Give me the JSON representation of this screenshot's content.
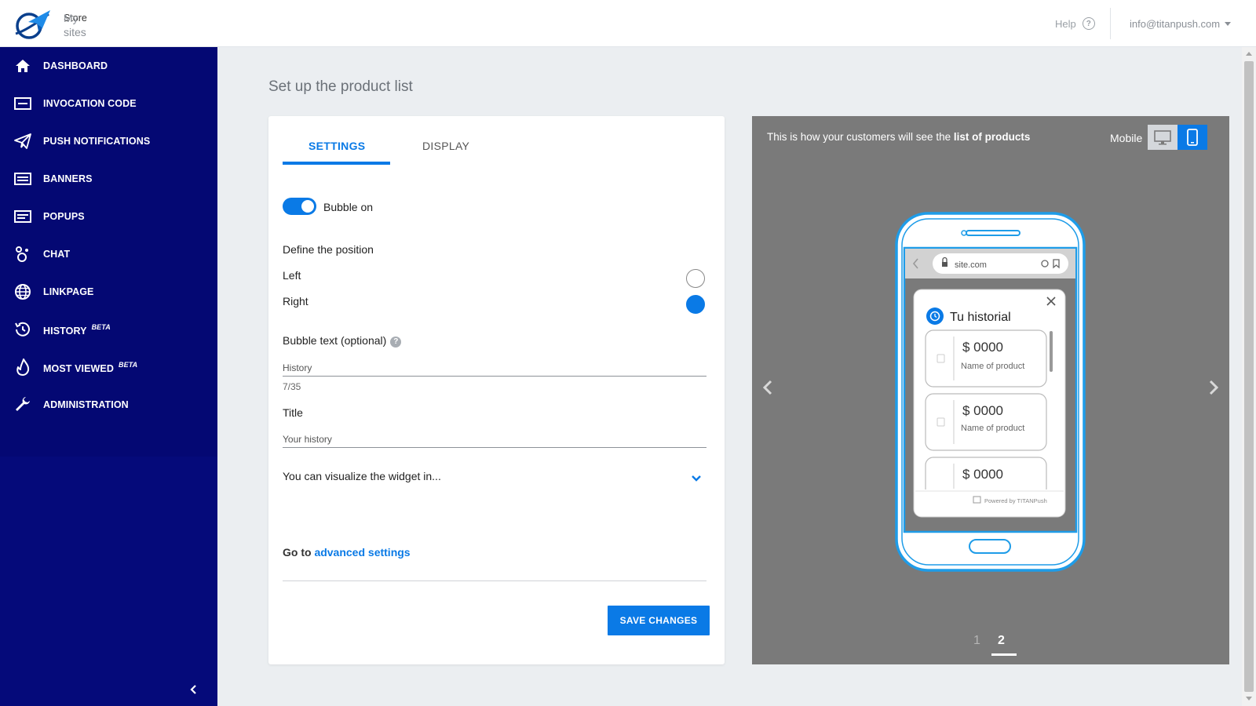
{
  "header": {
    "site_switch_label": "My sites",
    "site_name": "Store",
    "help_label": "Help",
    "account_email": "info@titanpush.com"
  },
  "sidebar": {
    "items": [
      {
        "label": "DASHBOARD",
        "icon": "home-icon"
      },
      {
        "label": "INVOCATION CODE",
        "icon": "code-icon"
      },
      {
        "label": "PUSH NOTIFICATIONS",
        "icon": "paper-plane-icon"
      },
      {
        "label": "BANNERS",
        "icon": "banner-icon"
      },
      {
        "label": "POPUPS",
        "icon": "popup-icon"
      },
      {
        "label": "CHAT",
        "icon": "chat-icon"
      },
      {
        "label": "LINKPAGE",
        "icon": "globe-icon"
      },
      {
        "label": "HISTORY",
        "icon": "history-icon",
        "badge": "BETA"
      },
      {
        "label": "MOST VIEWED",
        "icon": "flame-icon",
        "badge": "BETA"
      },
      {
        "label": "ADMINISTRATION",
        "icon": "wrench-icon"
      }
    ]
  },
  "main": {
    "page_title": "Set up the product list",
    "tabs": [
      {
        "label": "SETTINGS",
        "active": true
      },
      {
        "label": "DISPLAY",
        "active": false
      }
    ],
    "bubble_toggle": {
      "label": "Bubble on",
      "on": true
    },
    "position": {
      "heading": "Define the position",
      "options": [
        {
          "label": "Left",
          "selected": false
        },
        {
          "label": "Right",
          "selected": true
        }
      ]
    },
    "bubble_text": {
      "label": "Bubble text (optional)",
      "value": "History",
      "counter": "7/35"
    },
    "title_field": {
      "label": "Title",
      "value": "Your history"
    },
    "visualize_label": "You can visualize the widget in...",
    "advanced_prefix": "Go to",
    "advanced_link": "advanced settings",
    "save_button": "SAVE CHANGES"
  },
  "preview": {
    "text_prefix": "This is how your customers will see the",
    "text_bold": "list of products",
    "device_label": "Mobile",
    "url": "site.com",
    "widget_title": "Tu historial",
    "products": [
      {
        "price": "$ 0000",
        "name": "Name of product"
      },
      {
        "price": "$ 0000",
        "name": "Name of product"
      },
      {
        "price": "$ 0000",
        "name": ""
      }
    ],
    "powered_by": "Powered by TITANPush",
    "pages": [
      "1",
      "2"
    ],
    "active_page": "2"
  },
  "colors": {
    "sidebar": "#040873",
    "accent": "#0a7ae6",
    "preview_bg": "#7a7a7a"
  }
}
